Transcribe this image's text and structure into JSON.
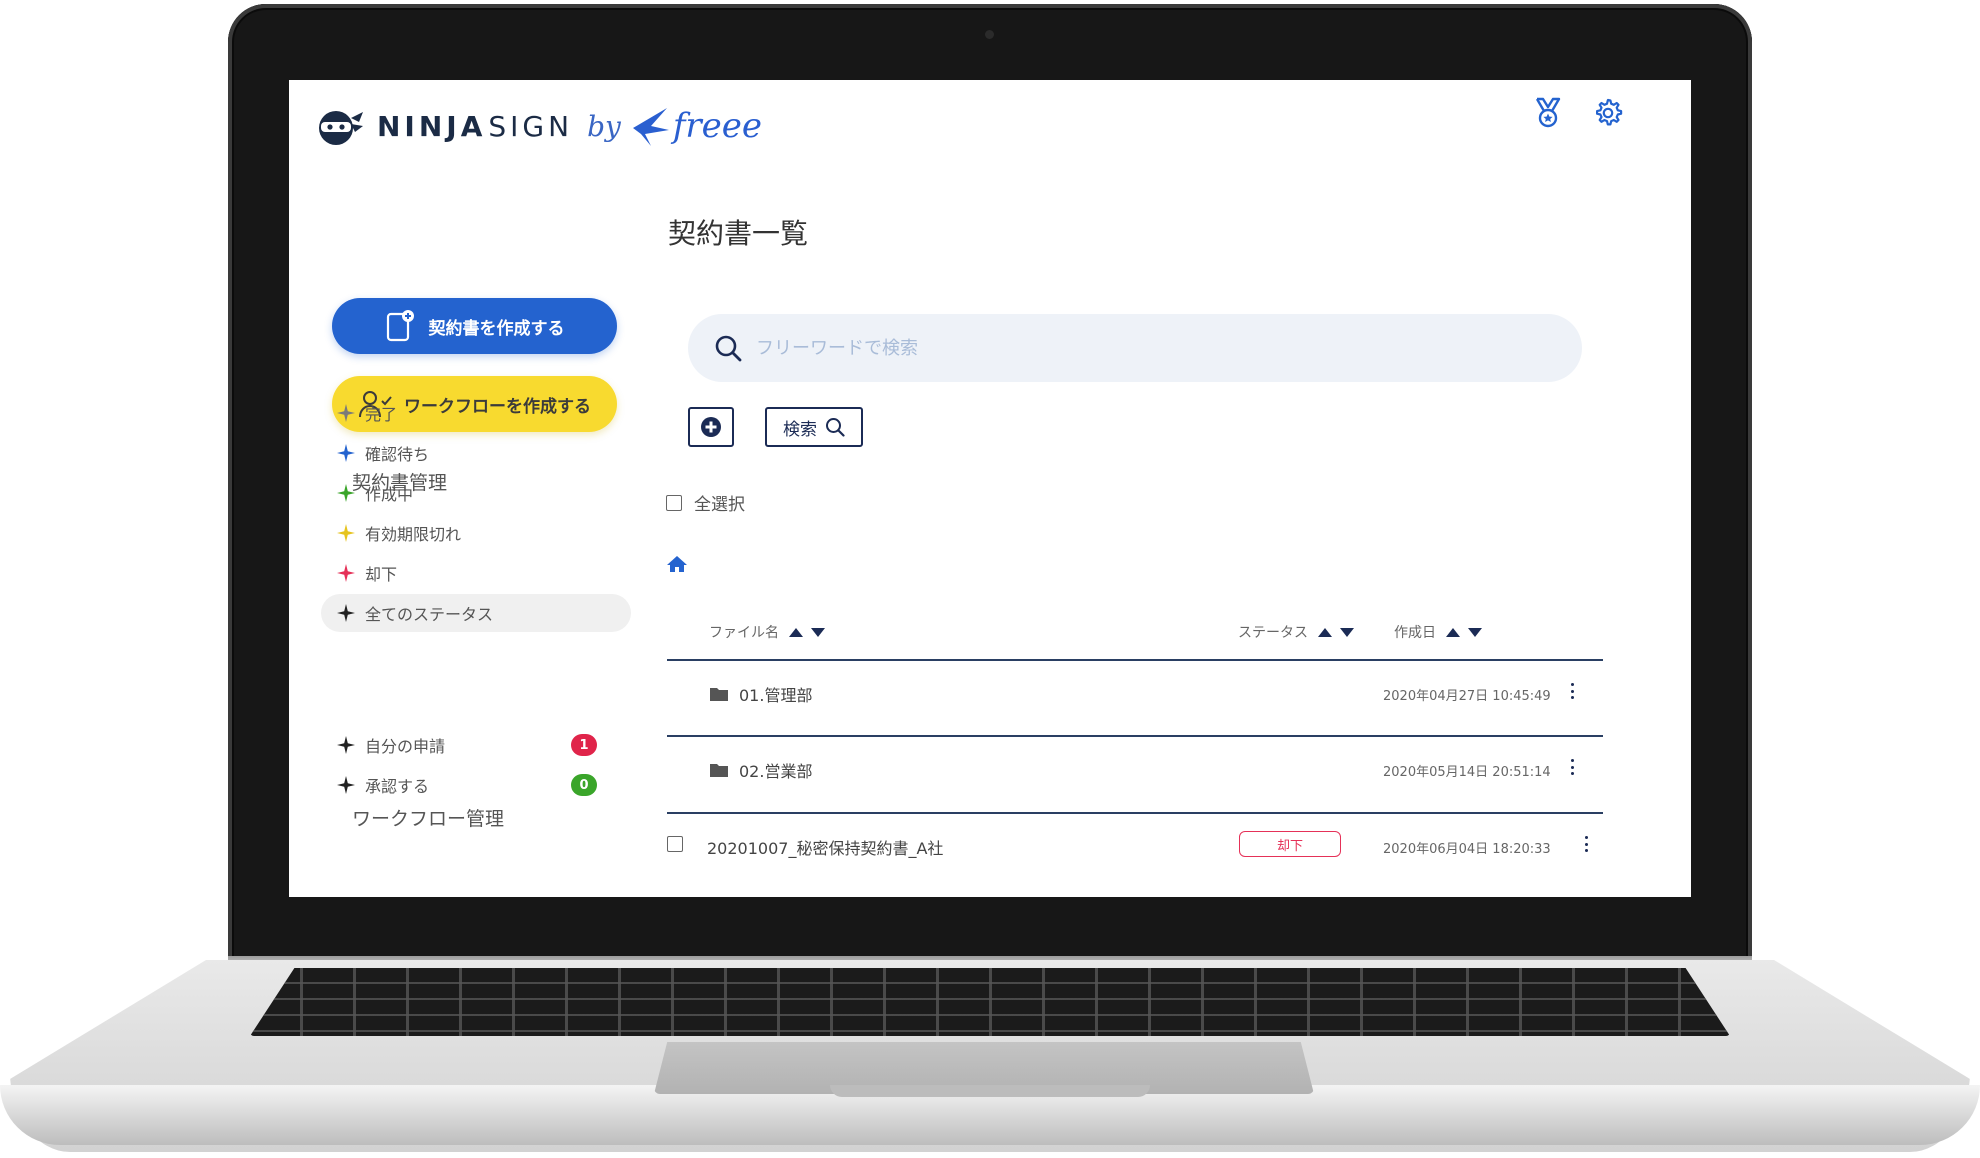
{
  "brand": {
    "ninja": "NINJA",
    "sign": "SIGN",
    "by": "by",
    "freee": "freee"
  },
  "header": {
    "icons": [
      "badge-ribbon-icon",
      "gear-icon"
    ]
  },
  "sidebar": {
    "create_contract_label": "契約書を作成する",
    "create_workflow_label": "ワークフローを作成する",
    "contract_section_title": "契約書管理",
    "contract_items": [
      {
        "label": "完了",
        "color": "#7a7a7a"
      },
      {
        "label": "確認待ち",
        "color": "#2463cf"
      },
      {
        "label": "作成中",
        "color": "#3aa52a"
      },
      {
        "label": "有効期限切れ",
        "color": "#e6c420"
      },
      {
        "label": "却下",
        "color": "#e53158"
      },
      {
        "label": "全てのステータス",
        "color": "#222222",
        "active": true
      }
    ],
    "workflow_section_title": "ワークフロー管理",
    "workflow_items": [
      {
        "label": "自分の申請",
        "badge": "1",
        "badge_color": "#e0244a"
      },
      {
        "label": "承認する",
        "badge": "0",
        "badge_color": "#3aa52a"
      }
    ]
  },
  "main": {
    "title": "契約書一覧",
    "search_placeholder": "フリーワードで検索",
    "search_button_label": "検索",
    "select_all_label": "全選択",
    "columns": {
      "filename": "ファイル名",
      "status": "ステータス",
      "created": "作成日"
    },
    "rows": [
      {
        "type": "folder",
        "name": "01.管理部",
        "date": "2020年04月27日 10:45:49"
      },
      {
        "type": "folder",
        "name": "02.営業部",
        "date": "2020年05月14日 20:51:14"
      },
      {
        "type": "file",
        "name": "20201007_秘密保持契約書_A社",
        "status": "却下",
        "date": "2020年06月04日 18:20:33"
      }
    ]
  },
  "colors": {
    "primary": "#2463cf",
    "workflow": "#f8da2f",
    "navy": "#1b2b55",
    "danger": "#e53158"
  }
}
